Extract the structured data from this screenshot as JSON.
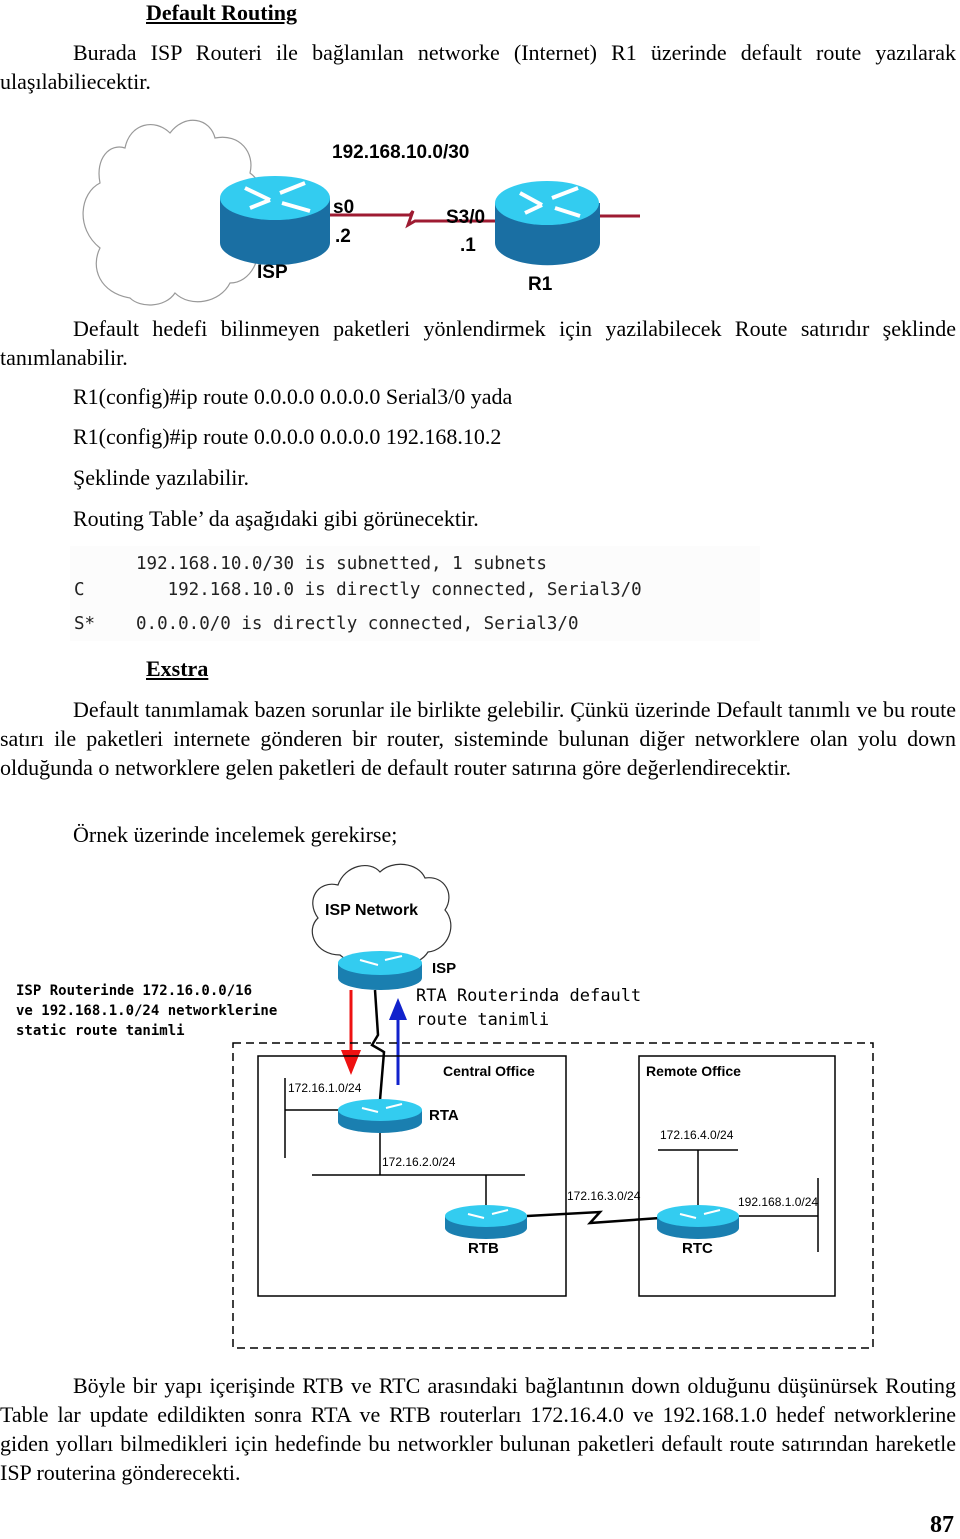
{
  "section1": {
    "title": "Default Routing",
    "intro": "Burada ISP Routeri ile bağlanılan networke (Internet) R1 üzerinde default route yazılarak ulaşılabiliecektir."
  },
  "diagram1": {
    "subnet_label": "192.168.10.0/30",
    "isp_label": "ISP",
    "r1_label": "R1",
    "isp_interface": "s0",
    "isp_address": ".2",
    "r1_interface": "S3/0",
    "r1_address": ".1",
    "colors": {
      "router_top": "#33ccf0",
      "router_body": "#1a6fa3",
      "link": "#9e1b32",
      "cloud": "#888888"
    }
  },
  "section2": {
    "paragraph": "Default hedefi bilinmeyen paketleri yönlendirmek için yazilabilecek Route satırıdır şeklinde tanımlanabilir.",
    "command1": "R1(config)#ip route 0.0.0.0 0.0.0.0 Serial3/0 yada",
    "command2": "R1(config)#ip route 0.0.0.0 0.0.0.0 192.168.10.2",
    "note": "Şeklinde yazılabilir.",
    "table_intro": "Routing Table’ da aşağıdaki gibi görünecektir."
  },
  "routing_table": {
    "rows": [
      {
        "code": "",
        "entry": "192.168.10.0/30 is subnetted, 1 subnets"
      },
      {
        "code": "C",
        "entry": "   192.168.10.0 is directly connected, Serial3/0"
      },
      {
        "code": "S*",
        "entry": "0.0.0.0/0 is directly connected, Serial3/0"
      }
    ]
  },
  "section3": {
    "title": "Exstra",
    "paragraph": "Default tanımlamak bazen sorunlar ile birlikte gelebilir. Çünkü üzerinde Default tanımlı ve bu route satırı ile paketleri internete gönderen bir router, sisteminde bulunan diğer networklere olan yolu down olduğunda o networklere gelen paketleri de default router satırına göre değerlendirecektir.",
    "example_intro": "Örnek üzerinde incelemek gerekirse;"
  },
  "diagram2": {
    "cloud_label": "ISP Network",
    "isp_label": "ISP",
    "left_note": [
      "ISP Routerinde 172.16.0.0/16",
      "ve 192.168.1.0/24 networklerine",
      "static route tanimli"
    ],
    "right_note": [
      "RTA Routerinda default",
      "route tanimli"
    ],
    "central_office": "Central Office",
    "remote_office": "Remote Office",
    "rta_label": "RTA",
    "rtb_label": "RTB",
    "rtc_label": "RTC",
    "net_172_16_1": "172.16.1.0/24",
    "net_172_16_2": "172.16.2.0/24",
    "net_172_16_3": "172.16.3.0/24",
    "net_172_16_4": "172.16.4.0/24",
    "net_192_168_1": "192.168.1.0/24",
    "colors": {
      "arrow_down": "#ee1111",
      "arrow_up": "#1122cc",
      "router_top": "#33ccf0",
      "router_body": "#1a7fb0"
    }
  },
  "section4": {
    "paragraph": "Böyle bir yapı içerişinde RTB ve RTC arasındaki bağlantının down olduğunu düşünürsek Routing Table lar update edildikten sonra RTA ve RTB routerları 172.16.4.0 ve 192.168.1.0 hedef networklerine giden yolları bilmedikleri için hedefinde bu networkler bulunan paketleri default route satırından hareketle ISP routerina gönderecekti."
  },
  "page_number": "87"
}
